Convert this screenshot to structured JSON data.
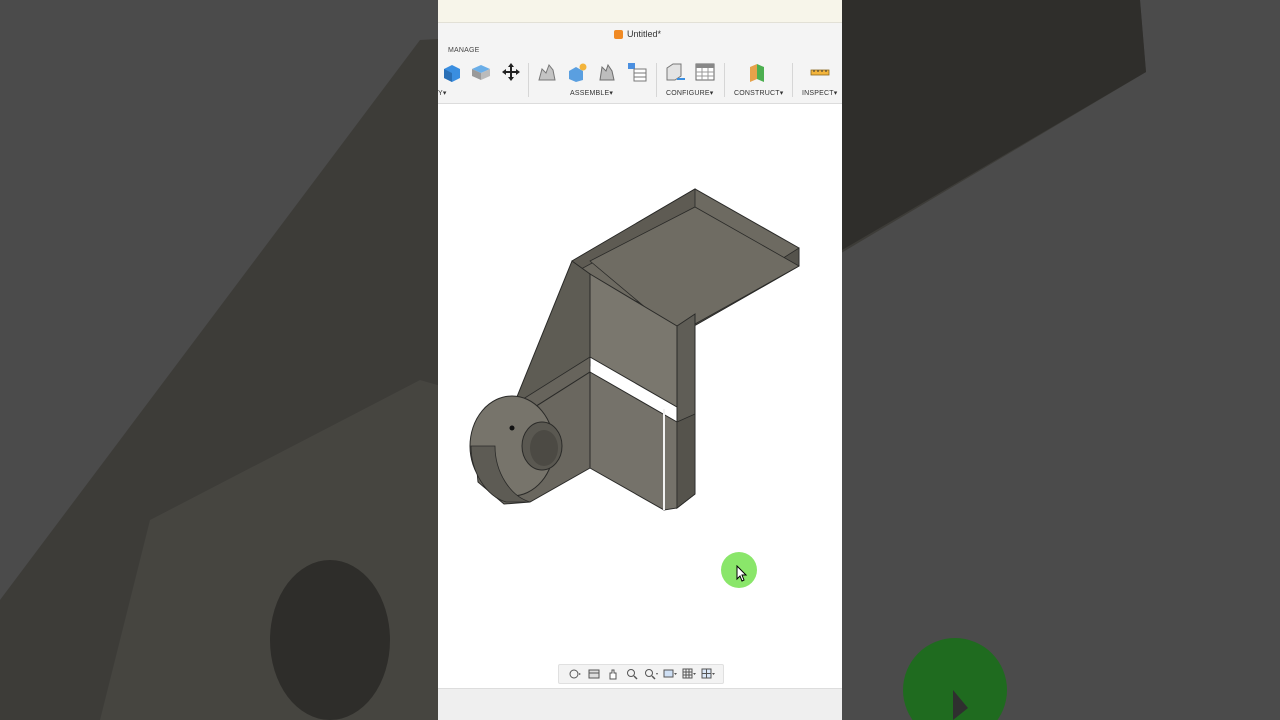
{
  "window": {
    "title": "Untitled*"
  },
  "toolbar": {
    "tab_label": "MANAGE",
    "groups": [
      {
        "label": "Y▾"
      },
      {
        "label": "ASSEMBLE▾"
      },
      {
        "label": "CONFIGURE▾"
      },
      {
        "label": "CONSTRUCT▾"
      },
      {
        "label": "INSPECT▾"
      }
    ]
  },
  "icons": {
    "doc": "fusion-doc-icon",
    "tools": [
      "box-icon",
      "press-pull-icon",
      "move-icon",
      "joint-icon",
      "new-component-icon",
      "as-built-joint-icon",
      "component-table-icon",
      "configure-icon",
      "table-icon",
      "plane-icon",
      "measure-icon"
    ],
    "nav": [
      "orbit-icon",
      "look-at-icon",
      "pan-icon",
      "zoom-window-icon",
      "zoom-icon",
      "display-settings-icon",
      "grid-icon",
      "viewports-icon"
    ]
  },
  "colors": {
    "model_face_light": "#7d7a70",
    "model_face_mid": "#6a675e",
    "model_face_dark": "#58564f",
    "cursor_highlight": "#7de35a",
    "doc_icon": "#f08a24"
  }
}
